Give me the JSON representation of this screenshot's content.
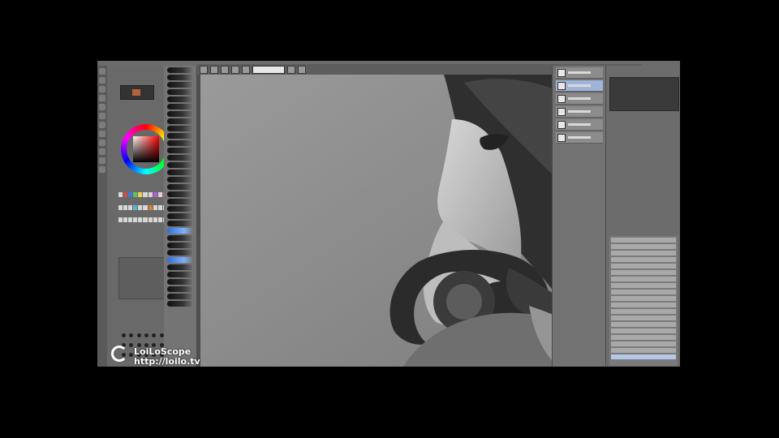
{
  "watermark": {
    "brand": "LoiLoScope",
    "url": "http://loilo.tv"
  },
  "colors": {
    "background": "#000000",
    "workspace": "#4f4f4f",
    "panel": "#6c6c6c",
    "canvas": "#8c8c8c",
    "accent_blue": "#2f6bd8",
    "brush_preview_color": "#b3643f"
  },
  "icons": {
    "tools": [
      "move-tool-icon",
      "pen-tool-icon",
      "eraser-tool-icon",
      "brush-tool-icon",
      "blend-tool-icon",
      "fill-tool-icon",
      "text-tool-icon",
      "selection-tool-icon",
      "eyedropper-tool-icon",
      "shape-tool-icon",
      "zoom-tool-icon",
      "hand-tool-icon"
    ],
    "color_panel": "color-wheel-icon",
    "brush_panel": "brush-preset-icon"
  }
}
